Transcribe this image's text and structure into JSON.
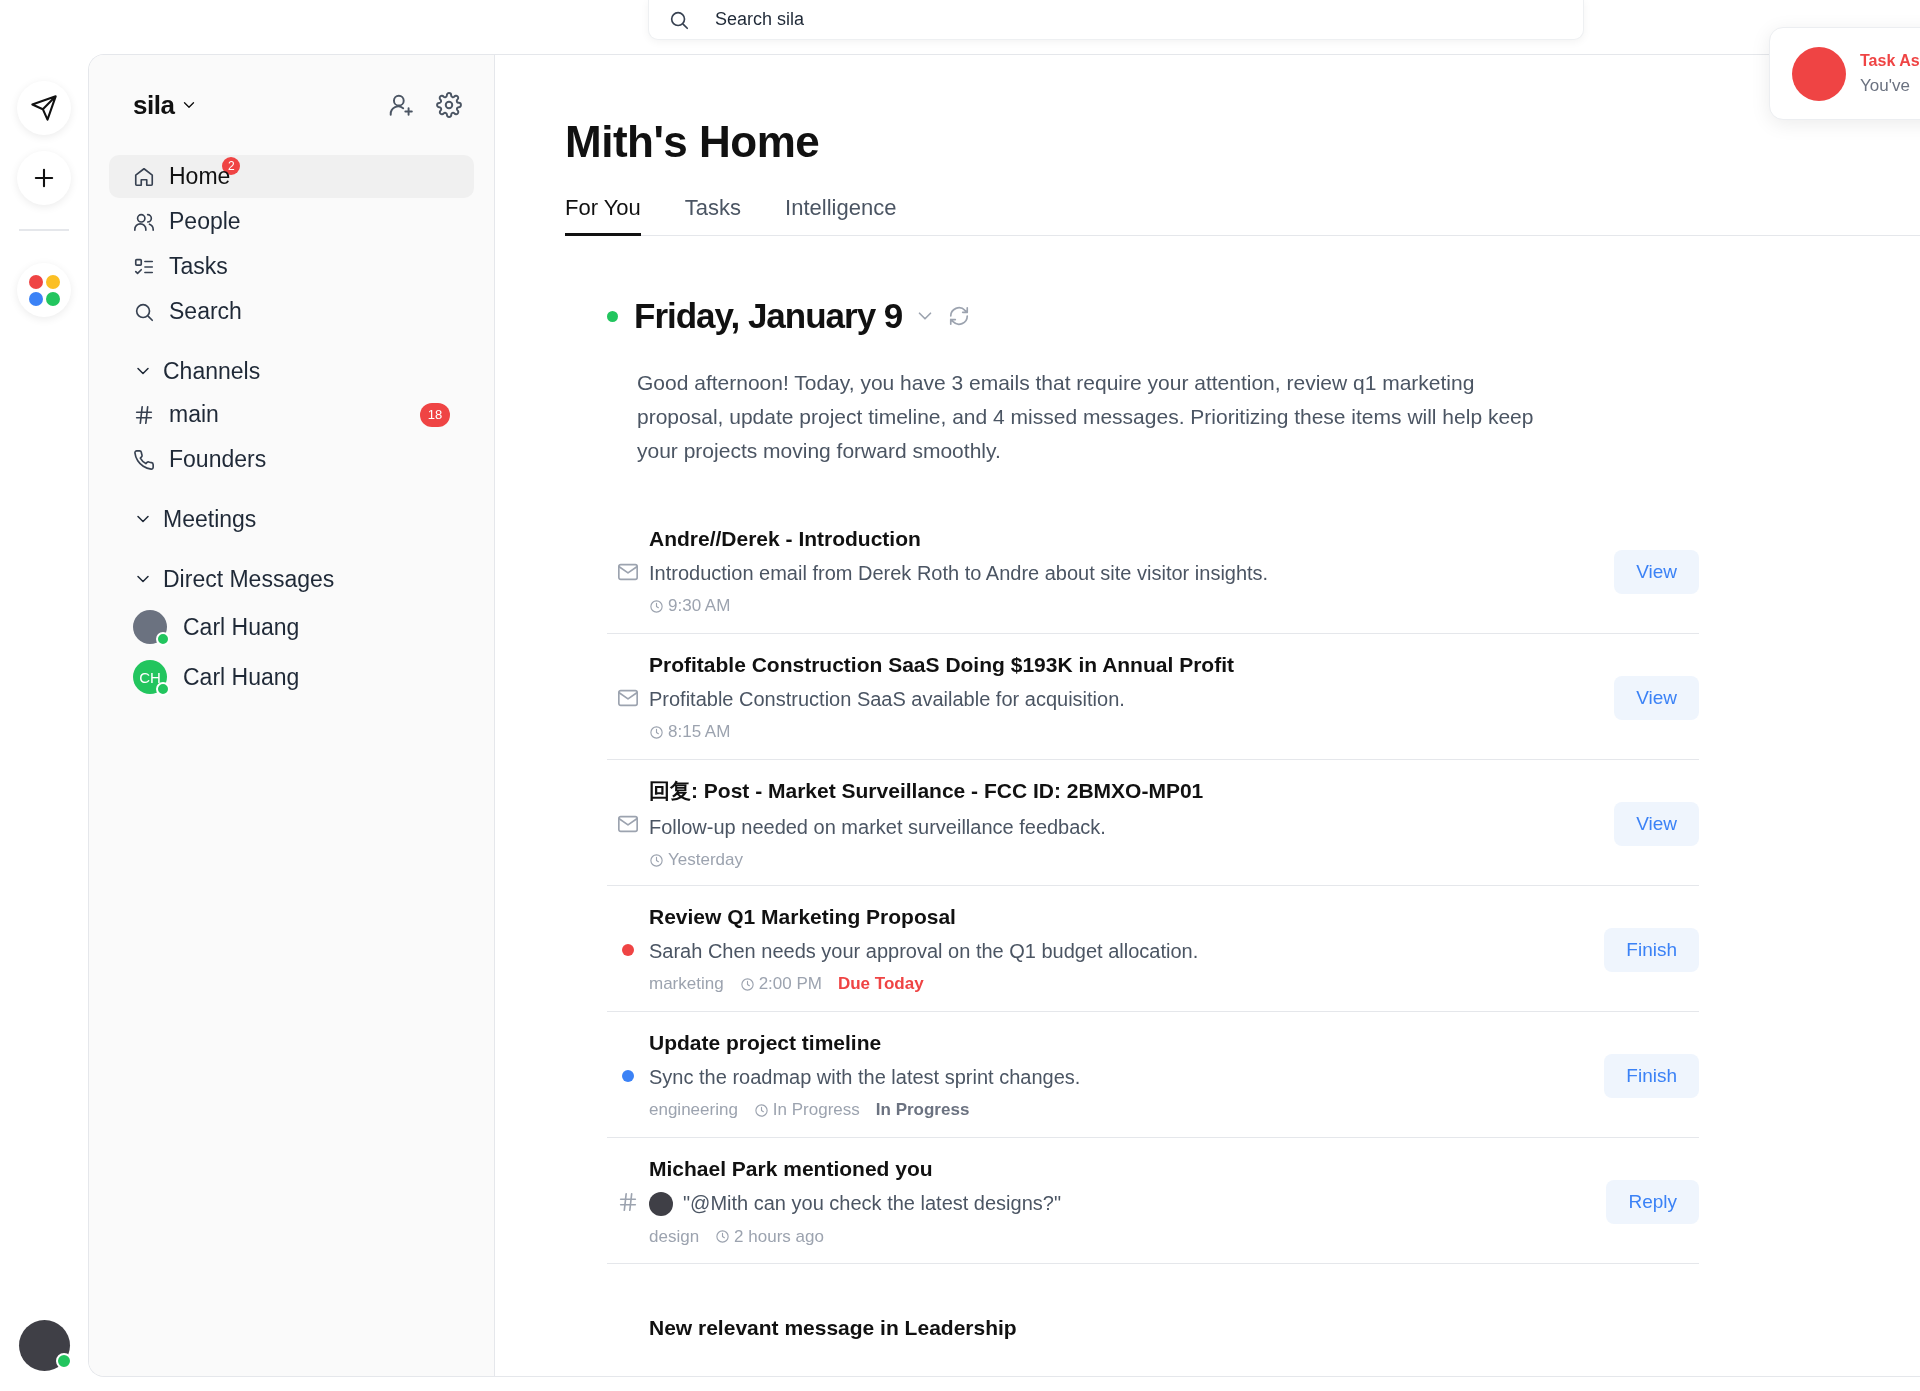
{
  "search": {
    "placeholder": "Search sila"
  },
  "toast": {
    "title": "Task As",
    "message": "You've"
  },
  "workspace": {
    "name": "sila"
  },
  "nav": [
    {
      "label": "Home",
      "selected": true,
      "badge": "2"
    },
    {
      "label": "People",
      "selected": false
    },
    {
      "label": "Tasks",
      "selected": false
    },
    {
      "label": "Search",
      "selected": false
    }
  ],
  "sections": [
    {
      "title": "Channels",
      "expanded": true,
      "items": [
        {
          "kind": "text",
          "name": "main",
          "badge": "18"
        },
        {
          "kind": "voice",
          "name": "Founders"
        }
      ]
    },
    {
      "title": "Meetings",
      "expanded": true
    },
    {
      "title": "Direct Messages",
      "expanded": true,
      "items": [
        {
          "kind": "photo",
          "name": "Carl Huang",
          "online": true
        },
        {
          "kind": "initials",
          "initials": "CH",
          "name": "Carl Huang",
          "online": true
        }
      ]
    }
  ],
  "page": {
    "title": "Mith's Home",
    "tabs": [
      {
        "label": "For You",
        "selected": true
      },
      {
        "label": "Tasks",
        "selected": false
      },
      {
        "label": "Intelligence",
        "selected": false
      }
    ],
    "date": "Friday, January 9",
    "summary": "Good afternoon! Today, you have 3 emails that require your attention, review q1 marketing proposal, update project timeline, and 4 missed messages. Prioritizing these items will help keep your projects moving forward smoothly."
  },
  "feed": [
    {
      "kind": "email",
      "title": "Andre//Derek - Introduction",
      "text": "Introduction email from Derek Roth to Andre about site visitor insights.",
      "time": "9:30 AM",
      "action": "View"
    },
    {
      "kind": "email",
      "title": "Profitable Construction SaaS Doing $193K in Annual Profit",
      "text": "Profitable Construction SaaS available for acquisition.",
      "time": "8:15 AM",
      "action": "View"
    },
    {
      "kind": "email",
      "title": "回复: Post - Market Surveillance - FCC ID: 2BMXO-MP01",
      "text": "Follow-up needed on market surveillance feedback.",
      "time": "Yesterday",
      "action": "View"
    },
    {
      "kind": "task",
      "color": "#ef4444",
      "title": "Review Q1 Marketing Proposal",
      "text": "Sarah Chen needs your approval on the Q1 budget allocation.",
      "tag": "marketing",
      "time": "2:00 PM",
      "status": "Due Today",
      "overdue": true,
      "action": "Finish"
    },
    {
      "kind": "task",
      "color": "#3b82f6",
      "title": "Update project timeline",
      "text": "Sync the roadmap with the latest sprint changes.",
      "tag": "engineering",
      "time": "In Progress",
      "status": "In Progress",
      "overdue": false,
      "action": "Finish"
    },
    {
      "kind": "mention",
      "title": "Michael Park mentioned you",
      "text": "\"@Mith can you check the latest designs?\"",
      "tag": "design",
      "time": "2 hours ago",
      "action": "Reply"
    },
    {
      "kind": "message",
      "title": "New relevant message in Leadership"
    }
  ]
}
